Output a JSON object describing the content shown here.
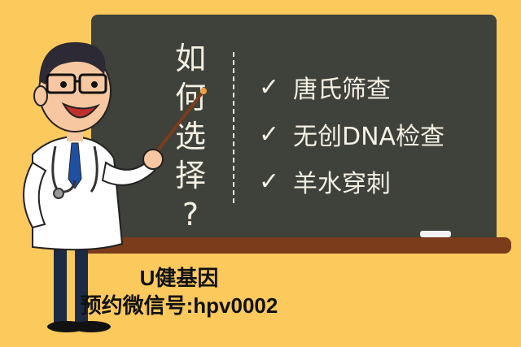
{
  "board": {
    "question_chars": [
      "如",
      "何",
      "选",
      "择",
      "?"
    ],
    "check_glyph": "✓",
    "items": [
      {
        "label": "唐氏筛查"
      },
      {
        "label": "无创DNA检查"
      },
      {
        "label": "羊水穿刺"
      }
    ]
  },
  "caption": {
    "line1": "U健基因",
    "line2": "预约微信号:hpv0002"
  },
  "colors": {
    "background": "#fbc95c",
    "chalkboard": "#3f413b",
    "tray": "#7a3c1b",
    "chalk_text": "#f4f0e2"
  }
}
